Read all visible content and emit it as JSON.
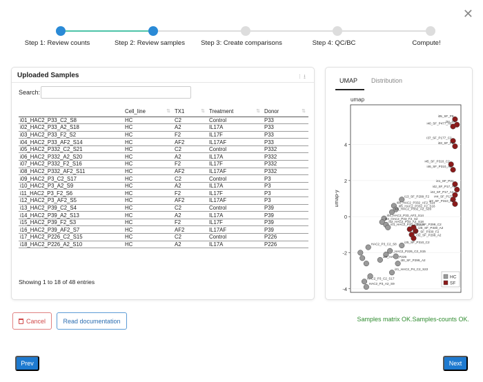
{
  "stepper": {
    "steps": [
      {
        "label": "Step 1: Review counts"
      },
      {
        "label": "Step 2: Review samples"
      },
      {
        "label": "Step 3: Create comparisons"
      },
      {
        "label": "Step 4: QC/BC"
      },
      {
        "label": "Compute!"
      }
    ],
    "completed": 2
  },
  "samples_card": {
    "title": "Uploaded Samples",
    "search_label": "Search:",
    "search_value": "",
    "columns": [
      "",
      "Cell_line",
      "TX1",
      "Treatment",
      "Donor"
    ],
    "rows": [
      [
        "i01_HAC2_P33_C2_S8",
        "HC",
        "C2",
        "Control",
        "P33"
      ],
      [
        "i02_HAC2_P33_A2_S18",
        "HC",
        "A2",
        "IL17A",
        "P33"
      ],
      [
        "i03_HAC2_P33_F2_S2",
        "HC",
        "F2",
        "IL17F",
        "P33"
      ],
      [
        "i04_HAC2_P33_AF2_S14",
        "HC",
        "AF2",
        "IL17AF",
        "P33"
      ],
      [
        "i05_HAC2_P332_C2_S21",
        "HC",
        "C2",
        "Control",
        "P332"
      ],
      [
        "i06_HAC2_P332_A2_S20",
        "HC",
        "A2",
        "IL17A",
        "P332"
      ],
      [
        "i07_HAC2_P332_F2_S16",
        "HC",
        "F2",
        "IL17F",
        "P332"
      ],
      [
        "i08_HAC2_P332_AF2_S11",
        "HC",
        "AF2",
        "IL17AF",
        "P332"
      ],
      [
        "i09_HAC2_P3_C2_S17",
        "HC",
        "C2",
        "Control",
        "P3"
      ],
      [
        "i10_HAC2_P3_A2_S9",
        "HC",
        "A2",
        "IL17A",
        "P3"
      ],
      [
        "i11_HAC2_P3_F2_S6",
        "HC",
        "F2",
        "IL17F",
        "P3"
      ],
      [
        "i12_HAC2_P3_AF2_S5",
        "HC",
        "AF2",
        "IL17AF",
        "P3"
      ],
      [
        "i13_HAC2_P39_C2_S4",
        "HC",
        "C2",
        "Control",
        "P39"
      ],
      [
        "i14_HAC2_P39_A2_S13",
        "HC",
        "A2",
        "IL17A",
        "P39"
      ],
      [
        "i15_HAC2_P39_F2_S3",
        "HC",
        "F2",
        "IL17F",
        "P39"
      ],
      [
        "i16_HAC2_P39_AF2_S7",
        "HC",
        "AF2",
        "IL17AF",
        "P39"
      ],
      [
        "i17_HAC2_P226_C2_S15",
        "HC",
        "C2",
        "Control",
        "P226"
      ],
      [
        "i18_HAC2_P226_A2_S10",
        "HC",
        "A2",
        "IL17A",
        "P226"
      ]
    ],
    "showing": "Showing 1 to 18 of 48 entries"
  },
  "plot_card": {
    "tabs": [
      "UMAP",
      "Distribution"
    ],
    "active_tab": "UMAP"
  },
  "chart_data": {
    "type": "scatter",
    "title": "umap",
    "xlabel": "",
    "ylabel": "umap-y",
    "ylim": [
      -4.2,
      6.2
    ],
    "y_ticks": [
      4,
      2,
      0,
      -2,
      -4
    ],
    "legend": {
      "placement": "bottom-right",
      "entries": [
        "HC",
        "SF"
      ]
    },
    "colors": {
      "HC": "#9a9a9a",
      "SF": "#8b1a1a"
    },
    "series": [
      {
        "name": "SF",
        "points": [
          {
            "label": "i40_SF_P477_A2",
            "x": 5.2,
            "y": 5.0
          },
          {
            "label": "i35_SF_P8",
            "x": 5.3,
            "y": 5.4
          },
          {
            "label": "i34_SF",
            "x": 5.4,
            "y": 5.1
          },
          {
            "label": "i37_SF_P177_C2",
            "x": 5.2,
            "y": 4.2
          },
          {
            "label": "i33_SF_P8",
            "x": 5.3,
            "y": 3.9
          },
          {
            "label": "i45_SF_P310_C2",
            "x": 5.1,
            "y": 2.9
          },
          {
            "label": "i46_SF_P310_A2",
            "x": 5.2,
            "y": 2.6
          },
          {
            "label": "i41_SF_P31",
            "x": 5.3,
            "y": 1.8
          },
          {
            "label": "i42_SF_P17_A2",
            "x": 5.4,
            "y": 1.5
          },
          {
            "label": "i43_SF_P17_A2",
            "x": 5.3,
            "y": 1.2
          },
          {
            "label": "i44_SF_P17",
            "x": 5.2,
            "y": 0.95
          },
          {
            "label": "i47_SF_P310_F2",
            "x": 5.3,
            "y": 0.7
          },
          {
            "label": "i29_SF_P299_C2",
            "x": 3.2,
            "y": -0.6
          },
          {
            "label": "i28_SF_P330_A2",
            "x": 3.3,
            "y": -0.8
          },
          {
            "label": "i27_SF_P330_F2",
            "x": 3.1,
            "y": -1.0
          },
          {
            "label": "i32_SF_P299_A2",
            "x": 3.2,
            "y": -1.2
          },
          {
            "label": "",
            "x": 3.0,
            "y": -0.7
          }
        ]
      },
      {
        "name": "HC",
        "points": [
          {
            "label": "i13_SF_P299_F2",
            "x": 2.6,
            "y": 0.95
          },
          {
            "label": "i08_HAC2_P332_AF2_S11",
            "x": 2.2,
            "y": 0.6
          },
          {
            "label": "i05_HAC2_P332_F2_S16",
            "x": 2.3,
            "y": 0.4
          },
          {
            "label": "i06_HAC2_P332_A2_S20",
            "x": 2.1,
            "y": 0.25
          },
          {
            "label": "i04_HAC2_P33_AF2_S14",
            "x": 1.7,
            "y": -0.1
          },
          {
            "label": "i03_HAC2_P33_F2_S2",
            "x": 1.6,
            "y": -0.3
          },
          {
            "label": "i02_HAC2_P33_A2_S18",
            "x": 1.8,
            "y": -0.45
          },
          {
            "label": "i01_HAC2_P33_C2_S8",
            "x": 1.9,
            "y": -0.6
          },
          {
            "label": "HAC2_P3_C2_S8",
            "x": 0.9,
            "y": -1.7
          },
          {
            "label": "i25_SF_P310_C2",
            "x": 2.6,
            "y": -1.6
          },
          {
            "label": "i17_HAC2_P226_C2_S15",
            "x": 1.8,
            "y": -2.1
          },
          {
            "label": "i22_HAC2_P226",
            "x": 1.5,
            "y": -2.4
          },
          {
            "label": "i30_SF_P299_A2",
            "x": 2.4,
            "y": -2.6
          },
          {
            "label": "i21_HAC2_P4_C2_S22",
            "x": 2.1,
            "y": -3.1
          },
          {
            "label": "HAC2_P3_C2_S17",
            "x": 0.7,
            "y": -3.6
          },
          {
            "label": "HAC2_P3_A2_S9",
            "x": 0.8,
            "y": -3.9
          },
          {
            "label": "",
            "x": 0.5,
            "y": -2.0
          },
          {
            "label": "",
            "x": 0.6,
            "y": -2.3
          },
          {
            "label": "",
            "x": 0.8,
            "y": -2.6
          },
          {
            "label": "",
            "x": 1.0,
            "y": -3.3
          },
          {
            "label": "",
            "x": 2.0,
            "y": -1.9
          },
          {
            "label": "",
            "x": 2.3,
            "y": -2.2
          }
        ]
      }
    ]
  },
  "footer": {
    "cancel_label": "Cancel",
    "docs_label": "Read documentation",
    "status": "Samples matrix OK.Samples-counts OK.",
    "prev_label": "Prev",
    "next_label": "Next"
  }
}
